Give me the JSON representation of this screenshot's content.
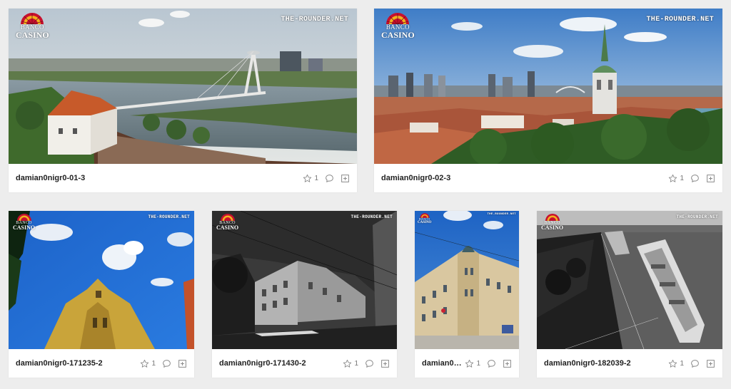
{
  "gallery": {
    "watermark": "THE-ROUNDER.NET",
    "logo_line1": "BANCO",
    "logo_line2": "CASINO",
    "items": [
      {
        "title": "damian0nigr0-01-3",
        "favorites": "1"
      },
      {
        "title": "damian0nigr0-02-3",
        "favorites": "1"
      },
      {
        "title": "damian0nigr0-171235-2",
        "favorites": "1"
      },
      {
        "title": "damian0nigr0-171430-2",
        "favorites": "1"
      },
      {
        "title": "damian0…",
        "favorites": "1"
      },
      {
        "title": "damian0nigr0-182039-2",
        "favorites": "1"
      }
    ]
  },
  "icons": {
    "favorite": "star-icon",
    "comment": "comment-bubble-icon",
    "add": "add-to-collection-icon"
  },
  "colors": {
    "page_bg": "#ededed",
    "card_bg": "#ffffff",
    "title_text": "#222222",
    "icon_gray": "#777777",
    "logo_red": "#c8102e",
    "logo_gold": "#f2b01e"
  }
}
